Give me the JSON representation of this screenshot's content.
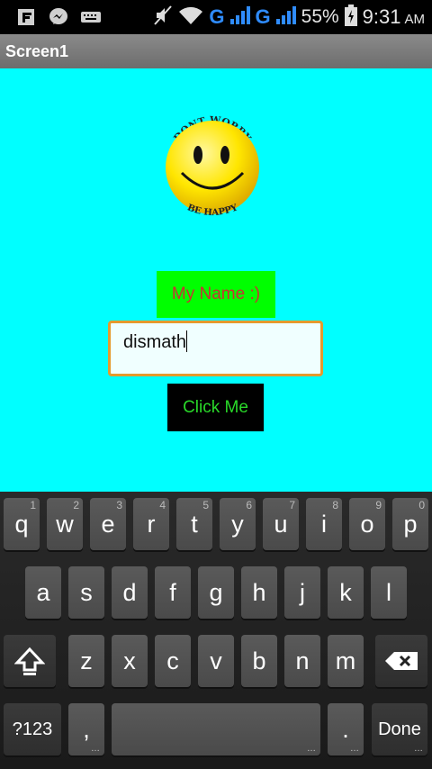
{
  "status_bar": {
    "icons": [
      "flipboard-icon",
      "messenger-icon",
      "keyboard-icon"
    ],
    "network_1": "G",
    "network_2": "G",
    "battery": "55%",
    "time": "9:31",
    "ampm": "AM"
  },
  "title_bar": {
    "title": "Screen1"
  },
  "app": {
    "smiley_top_text": "DONT WORRY",
    "smiley_bottom_text": "BE HAPPY",
    "name_label": "My Name :)",
    "text_value": "dismath",
    "button_label": "Click Me"
  },
  "keyboard": {
    "row1": [
      {
        "k": "q",
        "h": "1"
      },
      {
        "k": "w",
        "h": "2"
      },
      {
        "k": "e",
        "h": "3"
      },
      {
        "k": "r",
        "h": "4"
      },
      {
        "k": "t",
        "h": "5"
      },
      {
        "k": "y",
        "h": "6"
      },
      {
        "k": "u",
        "h": "7"
      },
      {
        "k": "i",
        "h": "8"
      },
      {
        "k": "o",
        "h": "9"
      },
      {
        "k": "p",
        "h": "0"
      }
    ],
    "row2": [
      "a",
      "s",
      "d",
      "f",
      "g",
      "h",
      "j",
      "k",
      "l"
    ],
    "row3": [
      "z",
      "x",
      "c",
      "v",
      "b",
      "n",
      "m"
    ],
    "symbols_label": "?123",
    "comma": ",",
    "period": ".",
    "done_label": "Done"
  },
  "colors": {
    "background": "#00ffff",
    "label_bg": "#00ff00",
    "label_text": "#c83232",
    "input_border": "#e59a2e",
    "button_bg": "#000000",
    "button_text": "#29d929"
  }
}
